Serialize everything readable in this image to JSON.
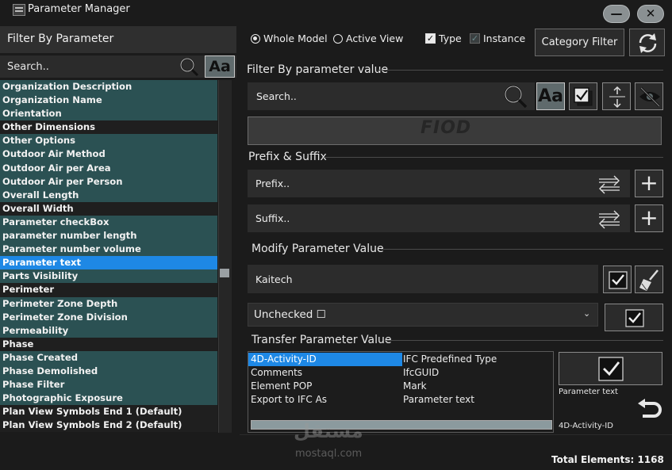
{
  "window": {
    "title": "Parameter Manager",
    "minimize_glyph": "—",
    "close_glyph": "✕"
  },
  "left_panel": {
    "header": "Filter By Parameter",
    "search_placeholder": "Search..",
    "case_button": "Aa",
    "items": [
      {
        "label": "Organization Description",
        "style": "teal"
      },
      {
        "label": "Organization Name",
        "style": "teal"
      },
      {
        "label": "Orientation",
        "style": "teal"
      },
      {
        "label": "Other Dimensions",
        "style": "dark"
      },
      {
        "label": "Other Options",
        "style": "teal"
      },
      {
        "label": "Outdoor Air Method",
        "style": "teal"
      },
      {
        "label": "Outdoor Air per Area",
        "style": "teal"
      },
      {
        "label": "Outdoor Air per Person",
        "style": "teal"
      },
      {
        "label": "Overall Length",
        "style": "teal"
      },
      {
        "label": "Overall Width",
        "style": "dark"
      },
      {
        "label": "Parameter checkBox",
        "style": "teal"
      },
      {
        "label": "parameter number length",
        "style": "teal"
      },
      {
        "label": "Parameter number volume",
        "style": "teal"
      },
      {
        "label": "Parameter text",
        "style": "sel"
      },
      {
        "label": "Parts Visibility",
        "style": "teal"
      },
      {
        "label": "Perimeter",
        "style": "dark"
      },
      {
        "label": "Perimeter Zone Depth",
        "style": "teal"
      },
      {
        "label": "Perimeter Zone Division",
        "style": "teal"
      },
      {
        "label": "Permeability",
        "style": "teal"
      },
      {
        "label": "Phase",
        "style": "dark"
      },
      {
        "label": "Phase Created",
        "style": "teal"
      },
      {
        "label": "Phase Demolished",
        "style": "teal"
      },
      {
        "label": "Phase Filter",
        "style": "teal"
      },
      {
        "label": "Photographic Exposure",
        "style": "teal"
      },
      {
        "label": "Plan View Symbols End 1 (Default)",
        "style": "dark"
      },
      {
        "label": "Plan View Symbols End 2 (Default)",
        "style": "dark"
      }
    ]
  },
  "top_bar": {
    "scope_options": [
      "Whole Model",
      "Active View"
    ],
    "scope_selected": "Whole Model",
    "type_label": "Type",
    "type_checked": true,
    "instance_label": "Instance",
    "instance_checked": true,
    "category_filter_label": "Category Filter"
  },
  "filter_value": {
    "section_label": "Filter By parameter value",
    "search_placeholder": "Search..",
    "case_button": "Aa",
    "logo_text": "FIOD"
  },
  "prefix_suffix": {
    "section_label": "Prefix & Suffix",
    "prefix_placeholder": "Prefix..",
    "suffix_placeholder": "Suffix..",
    "add_glyph": "+"
  },
  "modify": {
    "section_label": "Modify Parameter Value",
    "value": "Kaitech",
    "state_selected": "Unchecked ☐",
    "chevron_glyph": "⌄"
  },
  "transfer": {
    "section_label": "Transfer Parameter Value",
    "column1": [
      "4D-Activity-ID",
      "Comments",
      "Element POP",
      "Export to IFC As"
    ],
    "column2": [
      "IFC Predefined Type",
      "IfcGUID",
      "Mark",
      "Parameter text"
    ],
    "selected": "4D-Activity-ID",
    "source_label": "Parameter text",
    "target_label": "4D-Activity-ID"
  },
  "status": {
    "total_elements": "Total Elements: 1168"
  },
  "watermark": {
    "arabic": "مستقل",
    "latin": "mostaql.com"
  },
  "colors": {
    "background": "#1b1b1b",
    "teal_row": "#2b5153",
    "selection": "#1e88e5",
    "accent_button": "#5f6a6c"
  }
}
